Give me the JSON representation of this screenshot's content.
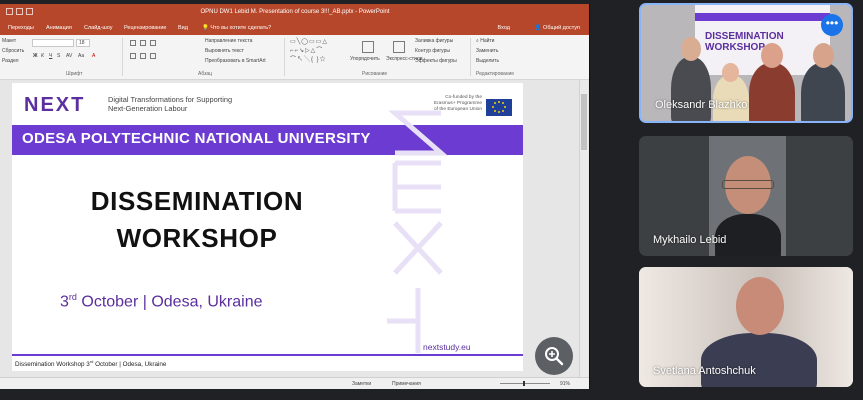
{
  "powerpoint": {
    "title": "OPNU DW1 Lebid M. Presentation of course 3!!!_AB.pptx - PowerPoint",
    "tabs": [
      "Переходы",
      "Анимация",
      "Слайд-шоу",
      "Рецензирование",
      "Вид"
    ],
    "ask_placeholder": "Что вы хотите сделать?",
    "login": "Вход",
    "share_label": "Общий доступ",
    "ribbon": {
      "macet": "Макет",
      "reset": "Сбросить",
      "section": "Раздел",
      "font_group": "Шрифт",
      "paragraph_group": "Абзац",
      "drawing_group": "Рисование",
      "editing_group": "Редактирование",
      "text_direction": "Направление текста",
      "align_text": "Выровнять текст",
      "smartart": "Преобразовать в SmartArt",
      "arrange": "Упорядочить",
      "quick_styles": "Экспресс-стили",
      "shape_fill": "Заливка фигуры",
      "shape_outline": "Контур фигуры",
      "shape_effects": "Эффекты фигуры",
      "find": "Найти",
      "replace": "Заменить",
      "select": "Выделить",
      "font_size": "18"
    },
    "status": {
      "notes": "Заметки",
      "comments": "Примечания",
      "zoom": "91%"
    }
  },
  "slide": {
    "logo": "NEXT",
    "logo_subtitle": "Digital Transformations for Supporting Next-Generation Labour",
    "eu_text": "Co-funded by the Erasmus+ Programme of the European Union",
    "band_title": "ODESA POLYTECHNIC NATIONAL UNIVERSITY",
    "title_line1": "DISSEMINATION",
    "title_line2": "WORKSHOP",
    "date_day": "3",
    "date_suffix": "rd",
    "date_rest": " October | Odesa, Ukraine",
    "website": "nextstudy.eu",
    "footer_pre": "Dissemination Workshop 3",
    "footer_sup": "rd",
    "footer_post": " October | Odesa, Ukraine"
  },
  "poster": {
    "line1": "DISSEMINATION",
    "line2": "WORKSHOP",
    "header": "ODESA POLYTECHNIC NATIONAL UNIVERSITY"
  },
  "participants": [
    {
      "name": "Oleksandr Blazhko"
    },
    {
      "name": "Mykhailo Lebid"
    },
    {
      "name": "Svetlana Antoshchuk"
    }
  ],
  "more_options_label": "•••"
}
